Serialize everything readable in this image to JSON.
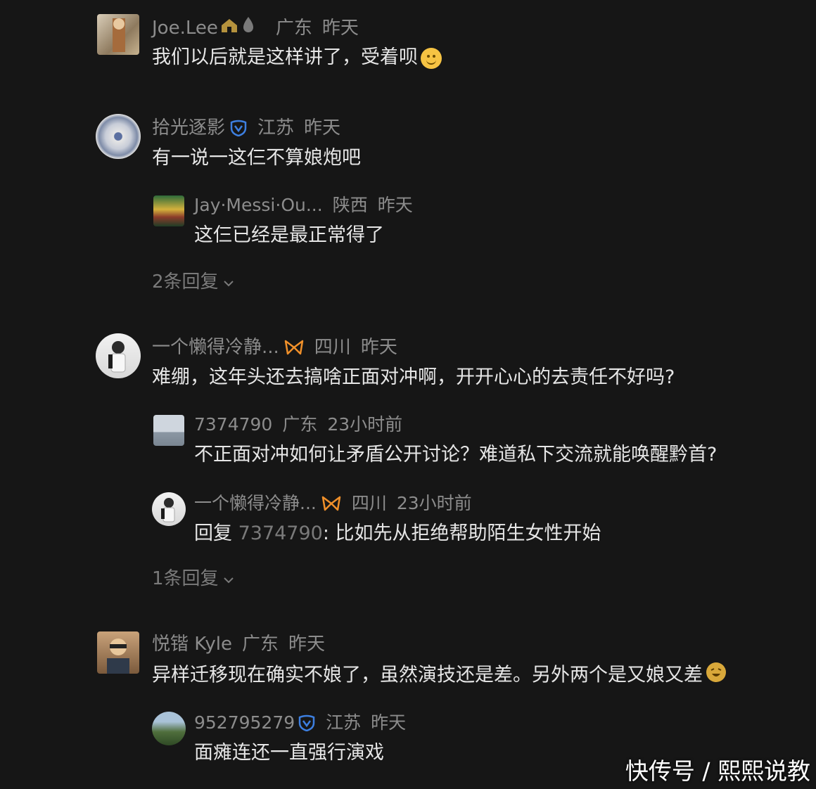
{
  "comments": [
    {
      "username": "Joe.Lee",
      "location": "广东",
      "time": "昨天",
      "text": "我们以后就是这样讲了，受着呗"
    },
    {
      "username": "拾光逐影",
      "location": "江苏",
      "time": "昨天",
      "text": "有一说一这仨不算娘炮吧",
      "replies": [
        {
          "username": "Jay·Messi·Ou...",
          "location": "陕西",
          "time": "昨天",
          "text": "这仨已经是最正常得了"
        }
      ],
      "more_replies": "2条回复"
    },
    {
      "username": "一个懒得冷静...",
      "location": "四川",
      "time": "昨天",
      "text": "难绷，这年头还去搞啥正面对冲啊，开开心心的去责任不好吗?",
      "replies": [
        {
          "username": "7374790",
          "location": "广东",
          "time": "23小时前",
          "text": "不正面对冲如何让矛盾公开讨论？难道私下交流就能唤醒黔首?"
        },
        {
          "username": "一个懒得冷静...",
          "location": "四川",
          "time": "23小时前",
          "reply_prefix": "回复",
          "reply_to": "7374790",
          "text": ": 比如先从拒绝帮助陌生女性开始"
        }
      ],
      "more_replies": "1条回复"
    },
    {
      "username": "悦锴 Kyle",
      "location": "广东",
      "time": "昨天",
      "text": "异样迁移现在确实不娘了，虽然演技还是差。另外两个是又娘又差",
      "replies": [
        {
          "username": "952795279",
          "location": "江苏",
          "time": "昨天",
          "text": "面瘫连还一直强行演戏"
        }
      ]
    }
  ],
  "watermark": "快传号 / 熙熙说教",
  "colors": {
    "background": "#161616",
    "text": "#e6e6e6",
    "meta": "#8c8c8c",
    "badge_blue": "#3d7fe0",
    "badge_orange": "#f0902a"
  }
}
